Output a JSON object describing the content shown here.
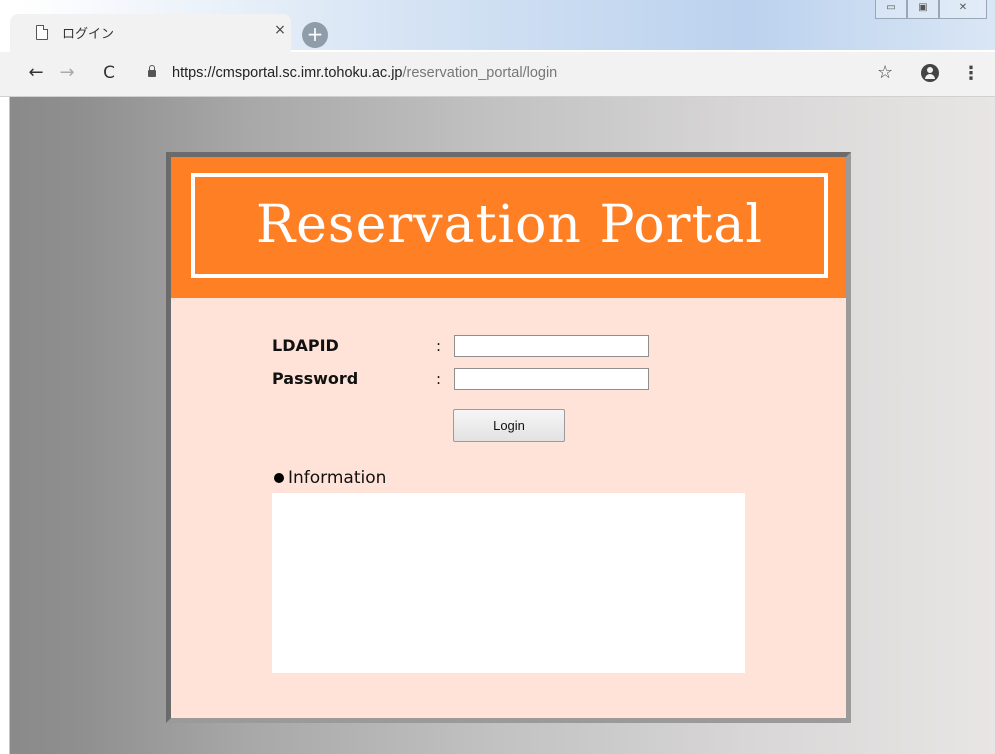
{
  "browser": {
    "tab": {
      "title": "ログイン",
      "close_label": "×"
    },
    "new_tab_label": "+",
    "window_controls": [
      "▭",
      "▣",
      "✕"
    ],
    "toolbar": {
      "back": "←",
      "forward": "→",
      "reload": "C",
      "url_host": "https://cmsportal.sc.imr.tohoku.ac.jp",
      "url_path": "/reservation_portal/login",
      "bookmark": "☆",
      "menu": "⋮"
    }
  },
  "page": {
    "banner_title": "Reservation Portal",
    "form": {
      "ldapid_label": "LDAPID",
      "password_label": "Password",
      "colon": ":",
      "ldapid_value": "",
      "password_value": "",
      "login_button": "Login"
    },
    "information": {
      "heading": "Information",
      "content": ""
    }
  },
  "colors": {
    "banner": "#ff7f24",
    "panel_background": "#ffe3d9",
    "banner_text": "#ffffff"
  }
}
